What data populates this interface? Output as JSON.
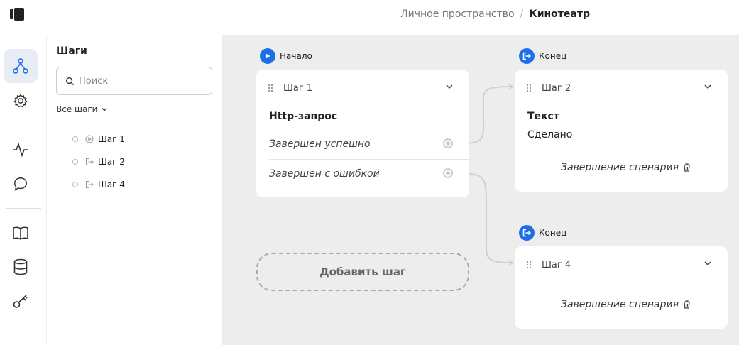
{
  "header": {
    "breadcrumb": [
      {
        "label": "Личное пространство"
      },
      {
        "label": "Кинотеатр"
      }
    ]
  },
  "rail": {
    "items": [
      {
        "icon": "workflow-icon",
        "active": true
      },
      {
        "icon": "gear-icon"
      },
      {
        "icon": "activity-icon"
      },
      {
        "icon": "chat-icon"
      },
      {
        "icon": "book-icon"
      },
      {
        "icon": "database-icon"
      },
      {
        "icon": "key-icon"
      }
    ]
  },
  "panel": {
    "title": "Шаги",
    "search_placeholder": "Поиск",
    "filter_label": "Все шаги",
    "steps": [
      {
        "label": "Шаг 1",
        "icon": "play-circle-icon"
      },
      {
        "label": "Шаг 2",
        "icon": "exit-icon"
      },
      {
        "label": "Шаг 4",
        "icon": "exit-icon"
      }
    ]
  },
  "canvas": {
    "start_label": "Начало",
    "end_label_1": "Конец",
    "end_label_2": "Конец",
    "step1": {
      "title": "Шаг 1",
      "type": "Http-запрос",
      "outcome_success": "Завершен успешно",
      "outcome_error": "Завершен с ошибкой"
    },
    "step2": {
      "title": "Шаг 2",
      "line1": "Текст",
      "line2": "Сделано",
      "finish": "Завершение сценария"
    },
    "step4": {
      "title": "Шаг 4",
      "finish": "Завершение сценария"
    },
    "add_step_label": "Добавить шаг"
  },
  "colors": {
    "accent": "#1c6fe8",
    "canvas_bg": "#ededed",
    "rail_active": "#e7ecf5"
  }
}
